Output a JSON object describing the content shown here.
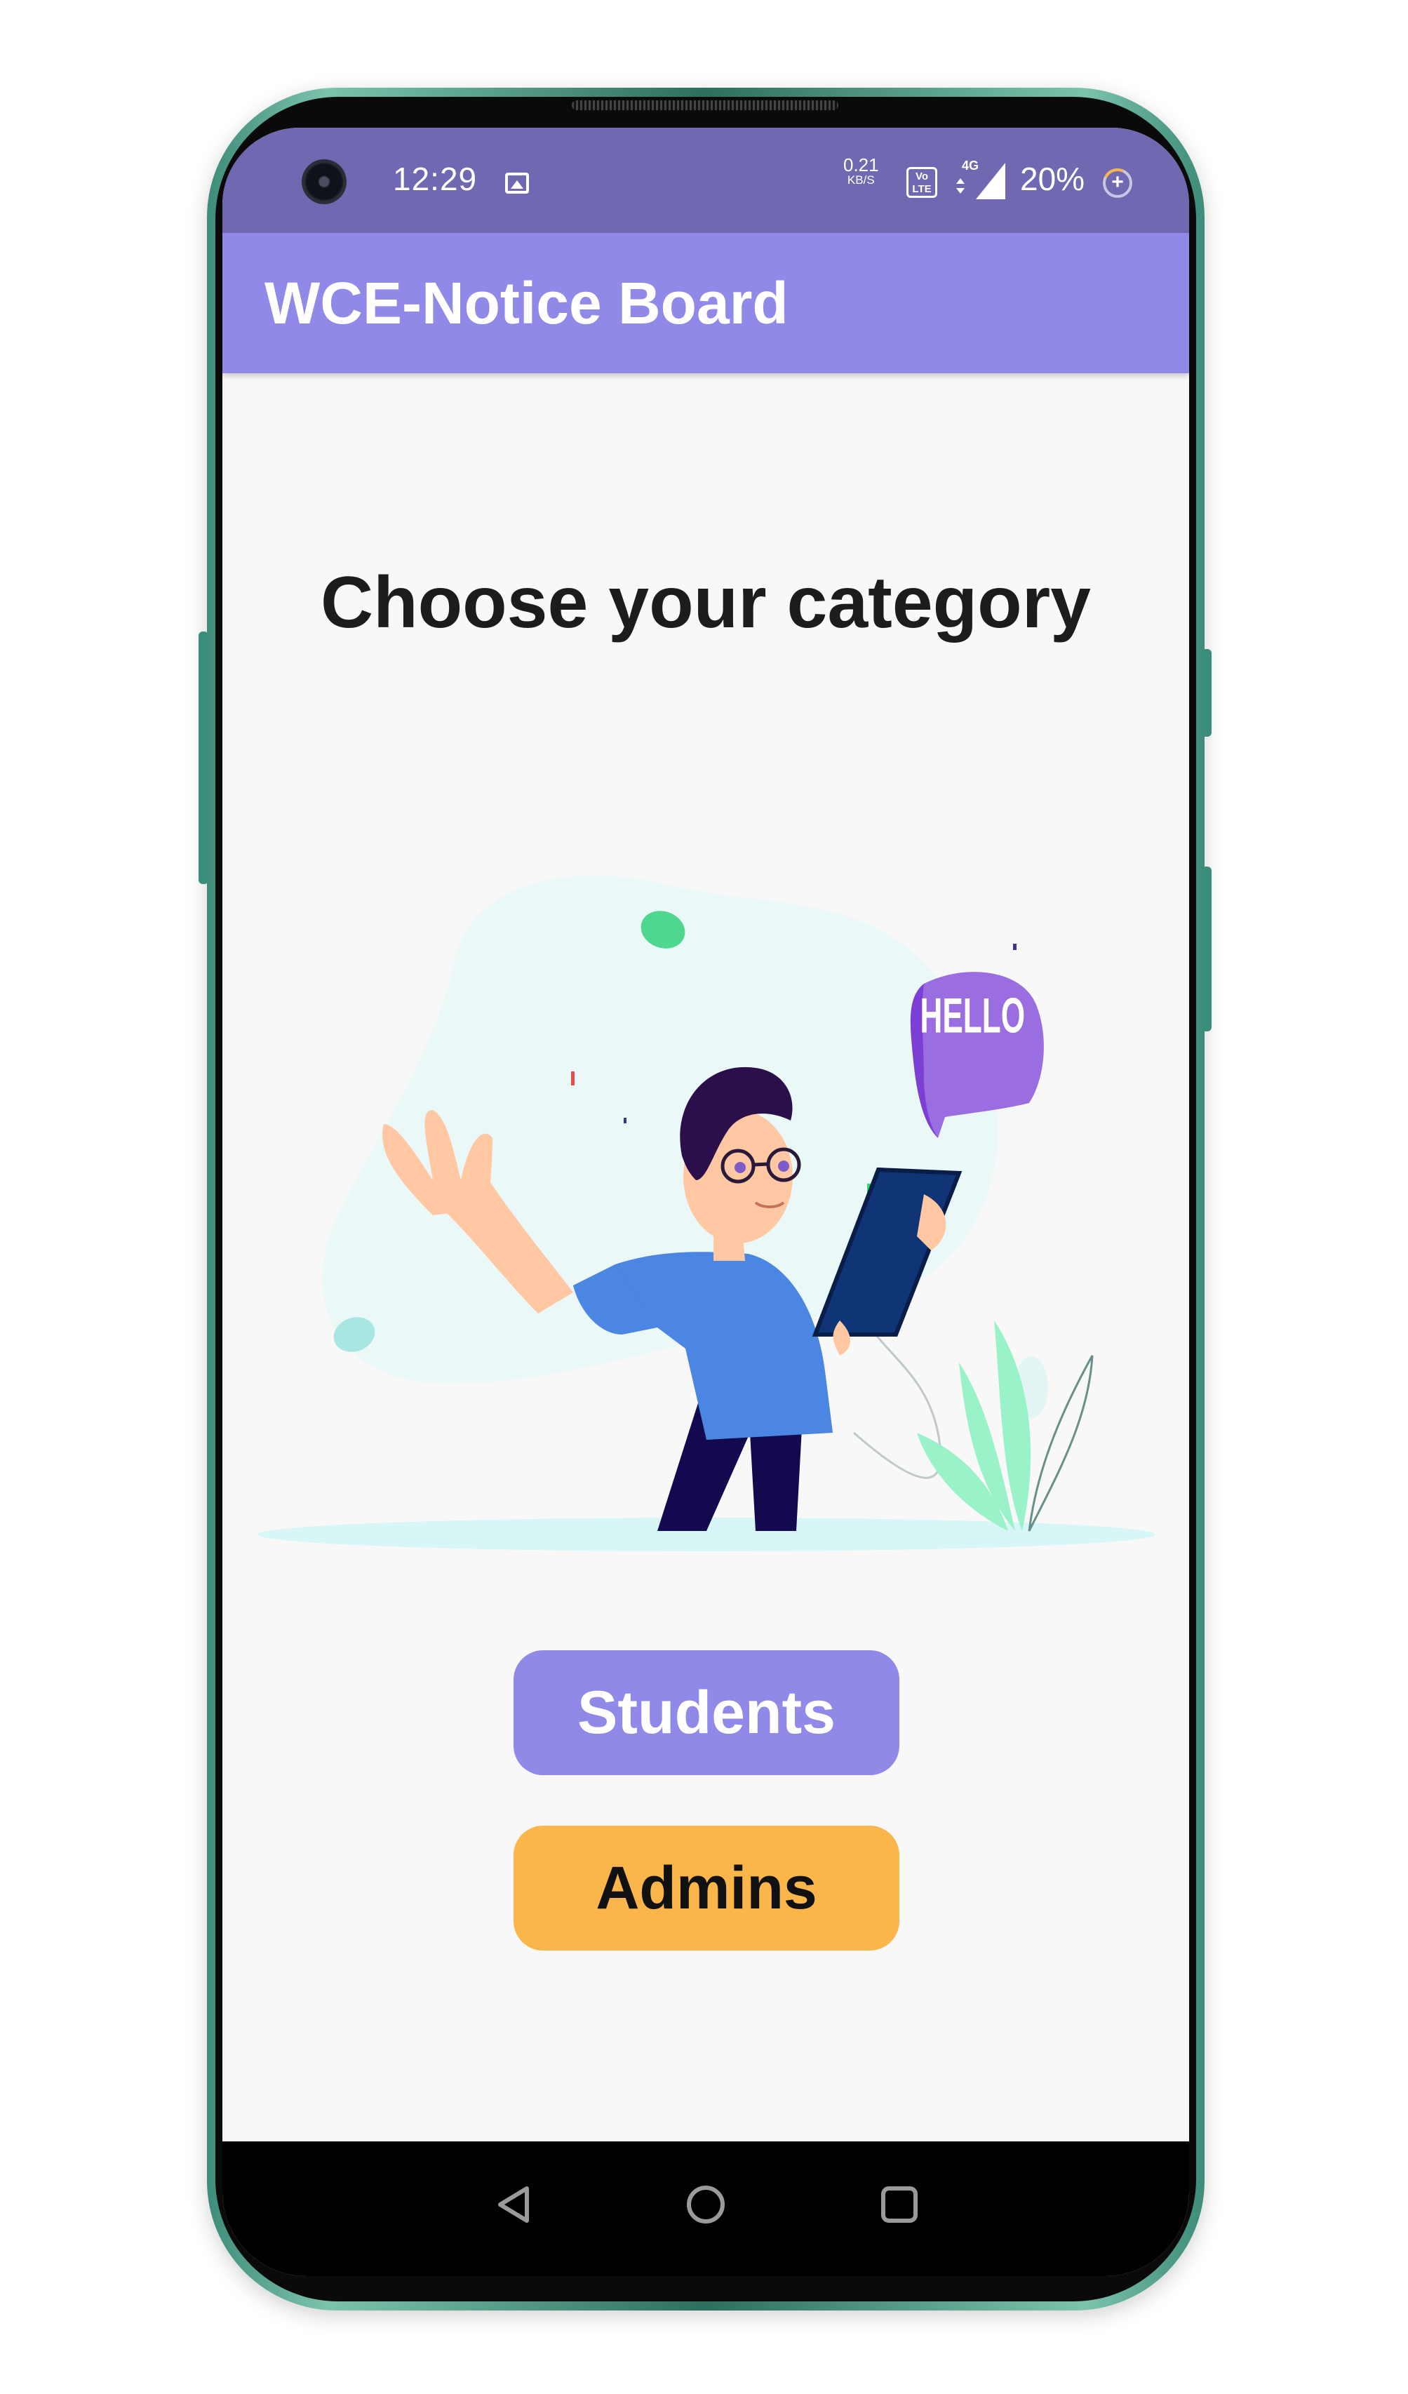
{
  "status_bar": {
    "time": "12:29",
    "net_speed_value": "0.21",
    "net_speed_unit": "KB/S",
    "volte_label": "Vo LTE",
    "signal_label": "4G",
    "battery_percent": "20%",
    "icons": [
      "camera-icon",
      "image-notification-icon",
      "volte-icon",
      "signal-icon",
      "battery-icon"
    ]
  },
  "app_bar": {
    "title": "WCE-Notice Board",
    "color": "#9089e8"
  },
  "main": {
    "heading": "Choose your category",
    "illustration": {
      "speech_bubble_text": "HELLO"
    },
    "buttons": {
      "students": "Students",
      "admins": "Admins"
    }
  },
  "colors": {
    "status_bar": "#7068b0",
    "app_bar": "#9089e8",
    "students_button": "#9089e8",
    "admins_button": "#fbb64b",
    "phone_frame": "#3e8c79"
  },
  "navigation": {
    "icons": [
      "back-icon",
      "home-icon",
      "recents-icon"
    ]
  }
}
